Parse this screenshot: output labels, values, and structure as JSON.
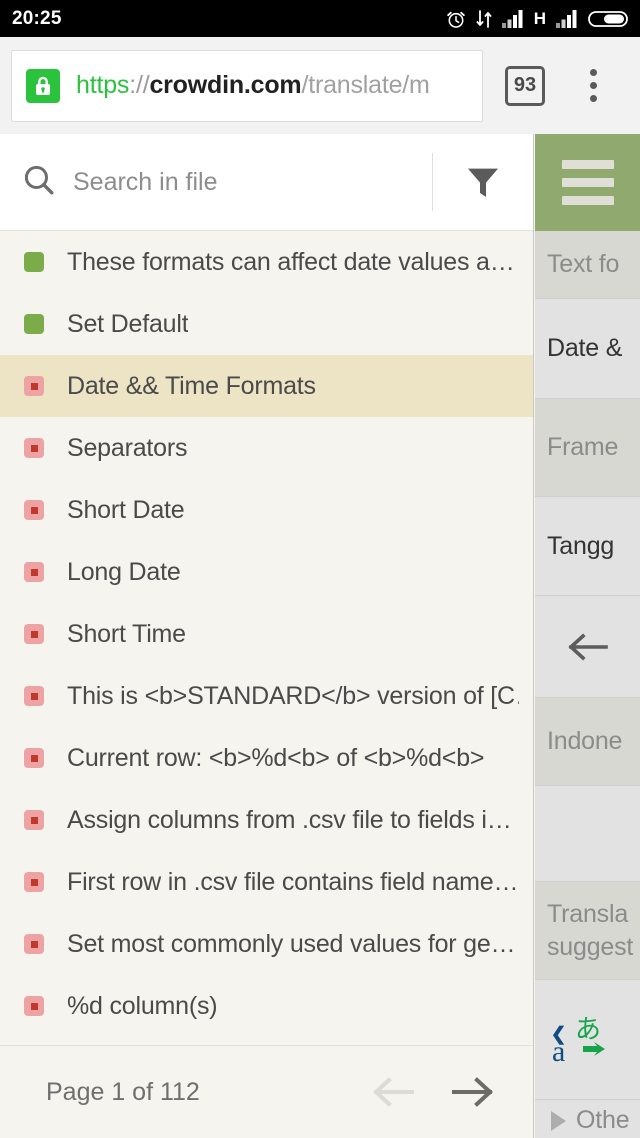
{
  "status_bar": {
    "time": "20:25",
    "network_letter": "H",
    "icons": [
      "alarm-clock-icon",
      "data-transfer-icon",
      "signal-bars-icon",
      "signal-bars-icon-2",
      "battery-icon"
    ]
  },
  "browser": {
    "url": {
      "scheme": "https",
      "separator": "://",
      "host": "crowdin.com",
      "path": "/translate/m"
    },
    "secure_icon": "lock-icon",
    "tab_count": "93",
    "menu_icon": "kebab-menu-icon"
  },
  "search": {
    "placeholder": "Search in file",
    "value": "",
    "icon": "search-icon",
    "filter_icon": "filter-funnel-icon"
  },
  "strings": [
    {
      "label": "These formats can affect date values a…",
      "status": "approved"
    },
    {
      "label": "Set Default",
      "status": "approved"
    },
    {
      "label": "Date && Time Formats",
      "status": "untranslated",
      "selected": true
    },
    {
      "label": "Separators",
      "status": "untranslated"
    },
    {
      "label": "Short Date",
      "status": "untranslated"
    },
    {
      "label": "Long Date",
      "status": "untranslated"
    },
    {
      "label": "Short Time",
      "status": "untranslated"
    },
    {
      "label": "This is <b>STANDARD</b> version of [C…",
      "status": "untranslated"
    },
    {
      "label": "Current row: <b>%d<b> of <b>%d<b>",
      "status": "untranslated"
    },
    {
      "label": "Assign columns from .csv file to fields i…",
      "status": "untranslated"
    },
    {
      "label": "First row in .csv file contains field name…",
      "status": "untranslated"
    },
    {
      "label": "Set most commonly used values for ge…",
      "status": "untranslated"
    },
    {
      "label": "%d column(s)",
      "status": "untranslated"
    }
  ],
  "pager": {
    "text": "Page 1 of 112",
    "prev_icon": "arrow-left-icon",
    "next_icon": "arrow-right-icon",
    "prev_enabled": false,
    "next_enabled": true
  },
  "translation_panel": {
    "menu_icon": "hamburger-menu-icon",
    "source_header": "Text fo",
    "source_text": "Date &",
    "frame_label": "Frame",
    "translation_value": "Tangg",
    "back_icon": "arrow-left-icon",
    "language_label": "Indone",
    "suggestion_line1": "Transla",
    "suggestion_line2": "suggest",
    "machine_translation_icon": "google-translate-icon",
    "other_label": "Othe",
    "other_icon": "triangle-right-icon"
  },
  "colors": {
    "accent_green": "#8fa96e",
    "approved": "#7cab4a",
    "untranslated": "#eda3a3",
    "untranslated_core": "#c0392b",
    "selected_row": "#ece4c5",
    "secure_green": "#2bc33e",
    "panel_bg": "#e0e0e0",
    "list_bg": "#f5f4ef"
  }
}
